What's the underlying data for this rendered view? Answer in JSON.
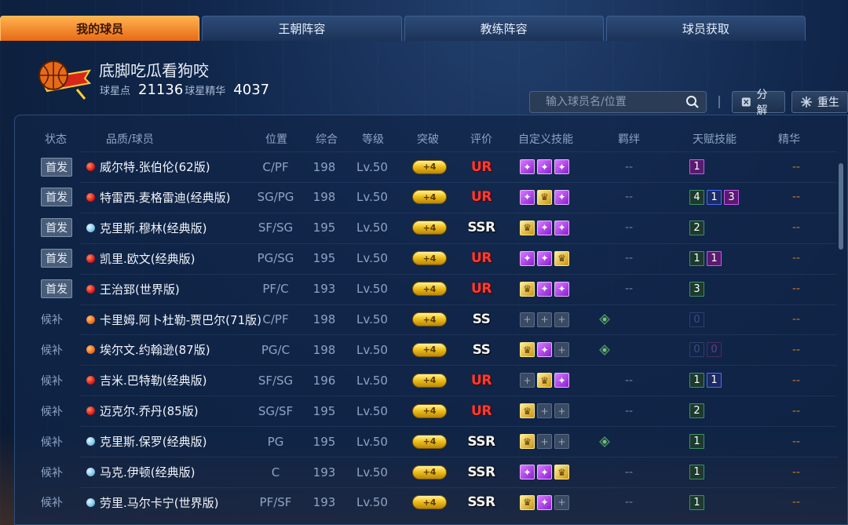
{
  "tabs": [
    {
      "label": "我的球员",
      "active": true
    },
    {
      "label": "王朝阵容",
      "active": false
    },
    {
      "label": "教练阵容",
      "active": false
    },
    {
      "label": "球员获取",
      "active": false
    }
  ],
  "profile": {
    "name": "底脚吃瓜看狗咬",
    "star_points_label": "球星点",
    "star_points": "21136",
    "essence_label": "球星精华",
    "essence": "4037"
  },
  "search": {
    "placeholder": "输入球员名/位置"
  },
  "actions": {
    "decompose": "分解",
    "reborn": "重生"
  },
  "columns": [
    "状态",
    "品质/球员",
    "位置",
    "综合",
    "等级",
    "突破",
    "评价",
    "自定义技能",
    "羁绊",
    "天赋技能",
    "精华"
  ],
  "rows": [
    {
      "status": "首发",
      "starter": true,
      "quality": "red",
      "name": "威尔特.张伯伦(62版)",
      "position": "C/PF",
      "overall": "198",
      "level": "Lv.50",
      "breakthrough": "+4",
      "rating": "UR",
      "skills": [
        "purple",
        "purple",
        "purple"
      ],
      "bond": "--",
      "talents": [
        {
          "v": "1",
          "c": "purple"
        }
      ],
      "essence": "--"
    },
    {
      "status": "首发",
      "starter": true,
      "quality": "red",
      "name": "特雷西.麦格雷迪(经典版)",
      "position": "SG/PG",
      "overall": "198",
      "level": "Lv.50",
      "breakthrough": "+4",
      "rating": "UR",
      "skills": [
        "purple",
        "gold",
        "purple"
      ],
      "bond": "--",
      "talents": [
        {
          "v": "4",
          "c": "green"
        },
        {
          "v": "1",
          "c": "blue"
        },
        {
          "v": "3",
          "c": "purple"
        }
      ],
      "essence": "--"
    },
    {
      "status": "首发",
      "starter": true,
      "quality": "blue",
      "name": "克里斯.穆林(经典版)",
      "position": "SF/SG",
      "overall": "195",
      "level": "Lv.50",
      "breakthrough": "+4",
      "rating": "SSR",
      "skills": [
        "gold",
        "purple",
        "purple"
      ],
      "bond": "--",
      "talents": [
        {
          "v": "2",
          "c": "green"
        }
      ],
      "essence": "--"
    },
    {
      "status": "首发",
      "starter": true,
      "quality": "red",
      "name": "凯里.欧文(经典版)",
      "position": "PG/SG",
      "overall": "195",
      "level": "Lv.50",
      "breakthrough": "+4",
      "rating": "UR",
      "skills": [
        "purple",
        "purple",
        "gold"
      ],
      "bond": "--",
      "talents": [
        {
          "v": "1",
          "c": "green"
        },
        {
          "v": "1",
          "c": "purple"
        }
      ],
      "essence": "--"
    },
    {
      "status": "首发",
      "starter": true,
      "quality": "red",
      "name": "王治郅(世界版)",
      "position": "PF/C",
      "overall": "193",
      "level": "Lv.50",
      "breakthrough": "+4",
      "rating": "UR",
      "skills": [
        "gold",
        "purple",
        "purple"
      ],
      "bond": "--",
      "talents": [
        {
          "v": "3",
          "c": "green"
        }
      ],
      "essence": "--"
    },
    {
      "status": "候补",
      "starter": false,
      "quality": "orange",
      "name": "卡里姆.阿卜杜勒-贾巴尔(71版)",
      "position": "C/PF",
      "overall": "198",
      "level": "Lv.50",
      "breakthrough": "+4",
      "rating": "SS",
      "skills": [
        "empty",
        "empty",
        "empty"
      ],
      "bond": "icon",
      "talents": [
        {
          "v": "0",
          "c": "dimblue"
        }
      ],
      "essence": "--"
    },
    {
      "status": "候补",
      "starter": false,
      "quality": "orange",
      "name": "埃尔文.约翰逊(87版)",
      "position": "PG/C",
      "overall": "198",
      "level": "Lv.50",
      "breakthrough": "+4",
      "rating": "SS",
      "skills": [
        "gold",
        "purple",
        "empty"
      ],
      "bond": "icon",
      "talents": [
        {
          "v": "0",
          "c": "dimblue"
        },
        {
          "v": "0",
          "c": "dimpurple"
        }
      ],
      "essence": "--"
    },
    {
      "status": "候补",
      "starter": false,
      "quality": "red",
      "name": "吉米.巴特勒(经典版)",
      "position": "SF/SG",
      "overall": "196",
      "level": "Lv.50",
      "breakthrough": "+4",
      "rating": "UR",
      "skills": [
        "empty",
        "gold",
        "purple"
      ],
      "bond": "--",
      "talents": [
        {
          "v": "1",
          "c": "green"
        },
        {
          "v": "1",
          "c": "blue"
        }
      ],
      "essence": "--"
    },
    {
      "status": "候补",
      "starter": false,
      "quality": "red",
      "name": "迈克尔.乔丹(85版)",
      "position": "SG/SF",
      "overall": "195",
      "level": "Lv.50",
      "breakthrough": "+4",
      "rating": "UR",
      "skills": [
        "gold",
        "empty",
        "empty"
      ],
      "bond": "--",
      "talents": [
        {
          "v": "2",
          "c": "green"
        }
      ],
      "essence": "--"
    },
    {
      "status": "候补",
      "starter": false,
      "quality": "blue",
      "name": "克里斯.保罗(经典版)",
      "position": "PG",
      "overall": "195",
      "level": "Lv.50",
      "breakthrough": "+4",
      "rating": "SSR",
      "skills": [
        "gold",
        "empty",
        "empty"
      ],
      "bond": "icon",
      "talents": [
        {
          "v": "1",
          "c": "green"
        }
      ],
      "essence": "--"
    },
    {
      "status": "候补",
      "starter": false,
      "quality": "blue",
      "name": "马克.伊顿(经典版)",
      "position": "C",
      "overall": "193",
      "level": "Lv.50",
      "breakthrough": "+4",
      "rating": "SSR",
      "skills": [
        "purple",
        "purple",
        "gold"
      ],
      "bond": "--",
      "talents": [
        {
          "v": "1",
          "c": "green"
        }
      ],
      "essence": "--"
    },
    {
      "status": "候补",
      "starter": false,
      "quality": "blue",
      "name": "劳里.马尔卡宁(世界版)",
      "position": "PF/SF",
      "overall": "193",
      "level": "Lv.50",
      "breakthrough": "+4",
      "rating": "SSR",
      "skills": [
        "gold",
        "purple",
        "empty"
      ],
      "bond": "--",
      "talents": [
        {
          "v": "1",
          "c": "green"
        }
      ],
      "essence": "--"
    }
  ]
}
